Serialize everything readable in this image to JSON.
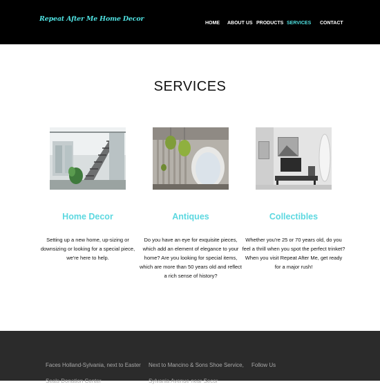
{
  "site": {
    "logo": "Repeat After Me Home Decor"
  },
  "nav": {
    "items": [
      {
        "label": "HOME"
      },
      {
        "label": "ABOUT US"
      },
      {
        "label": "PRODUCTS"
      },
      {
        "label": "SERVICES",
        "active": true
      },
      {
        "label": "CONTACT"
      }
    ]
  },
  "main": {
    "title": "SERVICES",
    "cards": [
      {
        "title": "Home Decor",
        "text": "Setting up a new home, up-sizing or downsizing or looking for a special piece, we're here to help."
      },
      {
        "title": "Antiques",
        "text": "Do you have an eye for exquisite pieces, which add an element of elegance to your home? Are you looking for special items, which are more than 50 years old and reflect a rich sense of history?"
      },
      {
        "title": "Collectibles",
        "text": "Whether you're 25 or 70 years old, do you feel a thrill when you spot the perfect trinket? When you visit Repeat After Me, get ready for a major rush!"
      }
    ]
  },
  "footer": {
    "col1": [
      "Faces Holland-Sylvania, next to Easter",
      "Seals Donation Center"
    ],
    "col2": [
      "Next to Mancino & Sons Shoe Service,",
      "Sylvania Avenue near Secor"
    ],
    "col3": "Follow Us"
  },
  "colors": {
    "accent": "#4fe0e0",
    "header_bg": "#000000",
    "footer_bg": "#2b2b2b",
    "card_title": "#5cd8e0"
  }
}
